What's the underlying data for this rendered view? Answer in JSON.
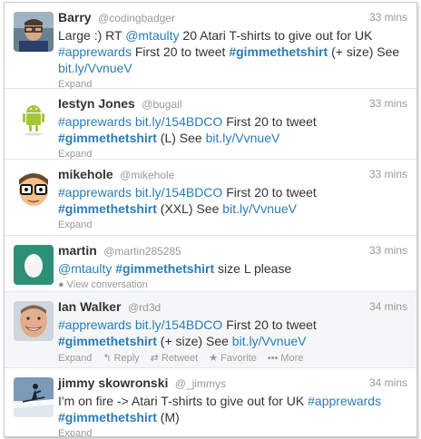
{
  "tweets": [
    {
      "name": "Barry",
      "handle": "@codingbadger",
      "time": "33 mins",
      "segments": [
        {
          "t": "text",
          "v": "Large :) RT "
        },
        {
          "t": "link",
          "v": "@mtaulty"
        },
        {
          "t": "text",
          "v": " 20 Atari T-shirts to give out for UK "
        },
        {
          "t": "tag",
          "v": "#apprewards"
        },
        {
          "t": "text",
          "v": " First 20 to tweet "
        },
        {
          "t": "tagb",
          "v": "#gimmethetshirt"
        },
        {
          "t": "text",
          "v": " (+ size) See "
        },
        {
          "t": "link",
          "v": "bit.ly/VvnueV"
        }
      ],
      "actions": [
        "Expand"
      ],
      "avatar": "photo-glasses-man"
    },
    {
      "name": "Iestyn Jones",
      "handle": "@bugail",
      "time": "33 mins",
      "segments": [
        {
          "t": "tag",
          "v": "#apprewards"
        },
        {
          "t": "text",
          "v": " "
        },
        {
          "t": "link",
          "v": "bit.ly/154BDCO"
        },
        {
          "t": "text",
          "v": " First 20 to tweet "
        },
        {
          "t": "tagb",
          "v": "#gimmethetshirt"
        },
        {
          "t": "text",
          "v": " (L) See "
        },
        {
          "t": "link",
          "v": "bit.ly/VvnueV"
        }
      ],
      "actions": [
        "Expand"
      ],
      "avatar": "android-robot"
    },
    {
      "name": "mikehole",
      "handle": "@mikehole",
      "time": "33 mins",
      "segments": [
        {
          "t": "tag",
          "v": "#apprewards"
        },
        {
          "t": "text",
          "v": " "
        },
        {
          "t": "link",
          "v": "bit.ly/154BDCO"
        },
        {
          "t": "text",
          "v": " First 20 to tweet "
        },
        {
          "t": "tagb",
          "v": "#gimmethetshirt"
        },
        {
          "t": "text",
          "v": " (XXL) See "
        },
        {
          "t": "link",
          "v": "bit.ly/VvnueV"
        }
      ],
      "actions": [
        "Expand"
      ],
      "avatar": "cartoon-glasses-face"
    },
    {
      "name": "martin",
      "handle": "@martin285285",
      "time": "33 mins",
      "segments": [
        {
          "t": "link",
          "v": "@mtaulty"
        },
        {
          "t": "text",
          "v": " "
        },
        {
          "t": "tagb",
          "v": "#gimmethetshirt"
        },
        {
          "t": "text",
          "v": " size L please"
        }
      ],
      "actions": [
        "View conversation"
      ],
      "avatar": "default-egg"
    },
    {
      "name": "Ian Walker",
      "handle": "@rd3d",
      "time": "34 mins",
      "segments": [
        {
          "t": "tag",
          "v": "#apprewards"
        },
        {
          "t": "text",
          "v": " "
        },
        {
          "t": "link",
          "v": "bit.ly/154BDCO"
        },
        {
          "t": "text",
          "v": " First 20 to tweet "
        },
        {
          "t": "tagb",
          "v": "#gimmethetshirt"
        },
        {
          "t": "text",
          "v": " (+ size) See "
        },
        {
          "t": "link",
          "v": "bit.ly/VvnueV"
        }
      ],
      "actions": [
        "Expand",
        "Reply",
        "Retweet",
        "Favorite",
        "More"
      ],
      "avatar": "photo-smiling-man",
      "highlighted": true
    },
    {
      "name": "jimmy skowronski",
      "handle": "@_jimmys",
      "time": "34 mins",
      "segments": [
        {
          "t": "text",
          "v": "I'm on fire -> Atari T-shirts to give out for UK "
        },
        {
          "t": "tag",
          "v": "#apprewards"
        },
        {
          "t": "text",
          "v": " "
        },
        {
          "t": "tagb",
          "v": "#gimmethetshirt"
        },
        {
          "t": "text",
          "v": " (M)"
        }
      ],
      "actions": [
        "Expand"
      ],
      "avatar": "photo-skier"
    }
  ],
  "icons": {
    "View conversation": "speech-bubble-icon",
    "Reply": "reply-arrow-icon",
    "Retweet": "retweet-icon",
    "Favorite": "star-icon",
    "More": "ellipsis-icon"
  },
  "colors": {
    "link": "#2a7cb6",
    "highlight": "#f7f11c",
    "muted": "#999999"
  }
}
